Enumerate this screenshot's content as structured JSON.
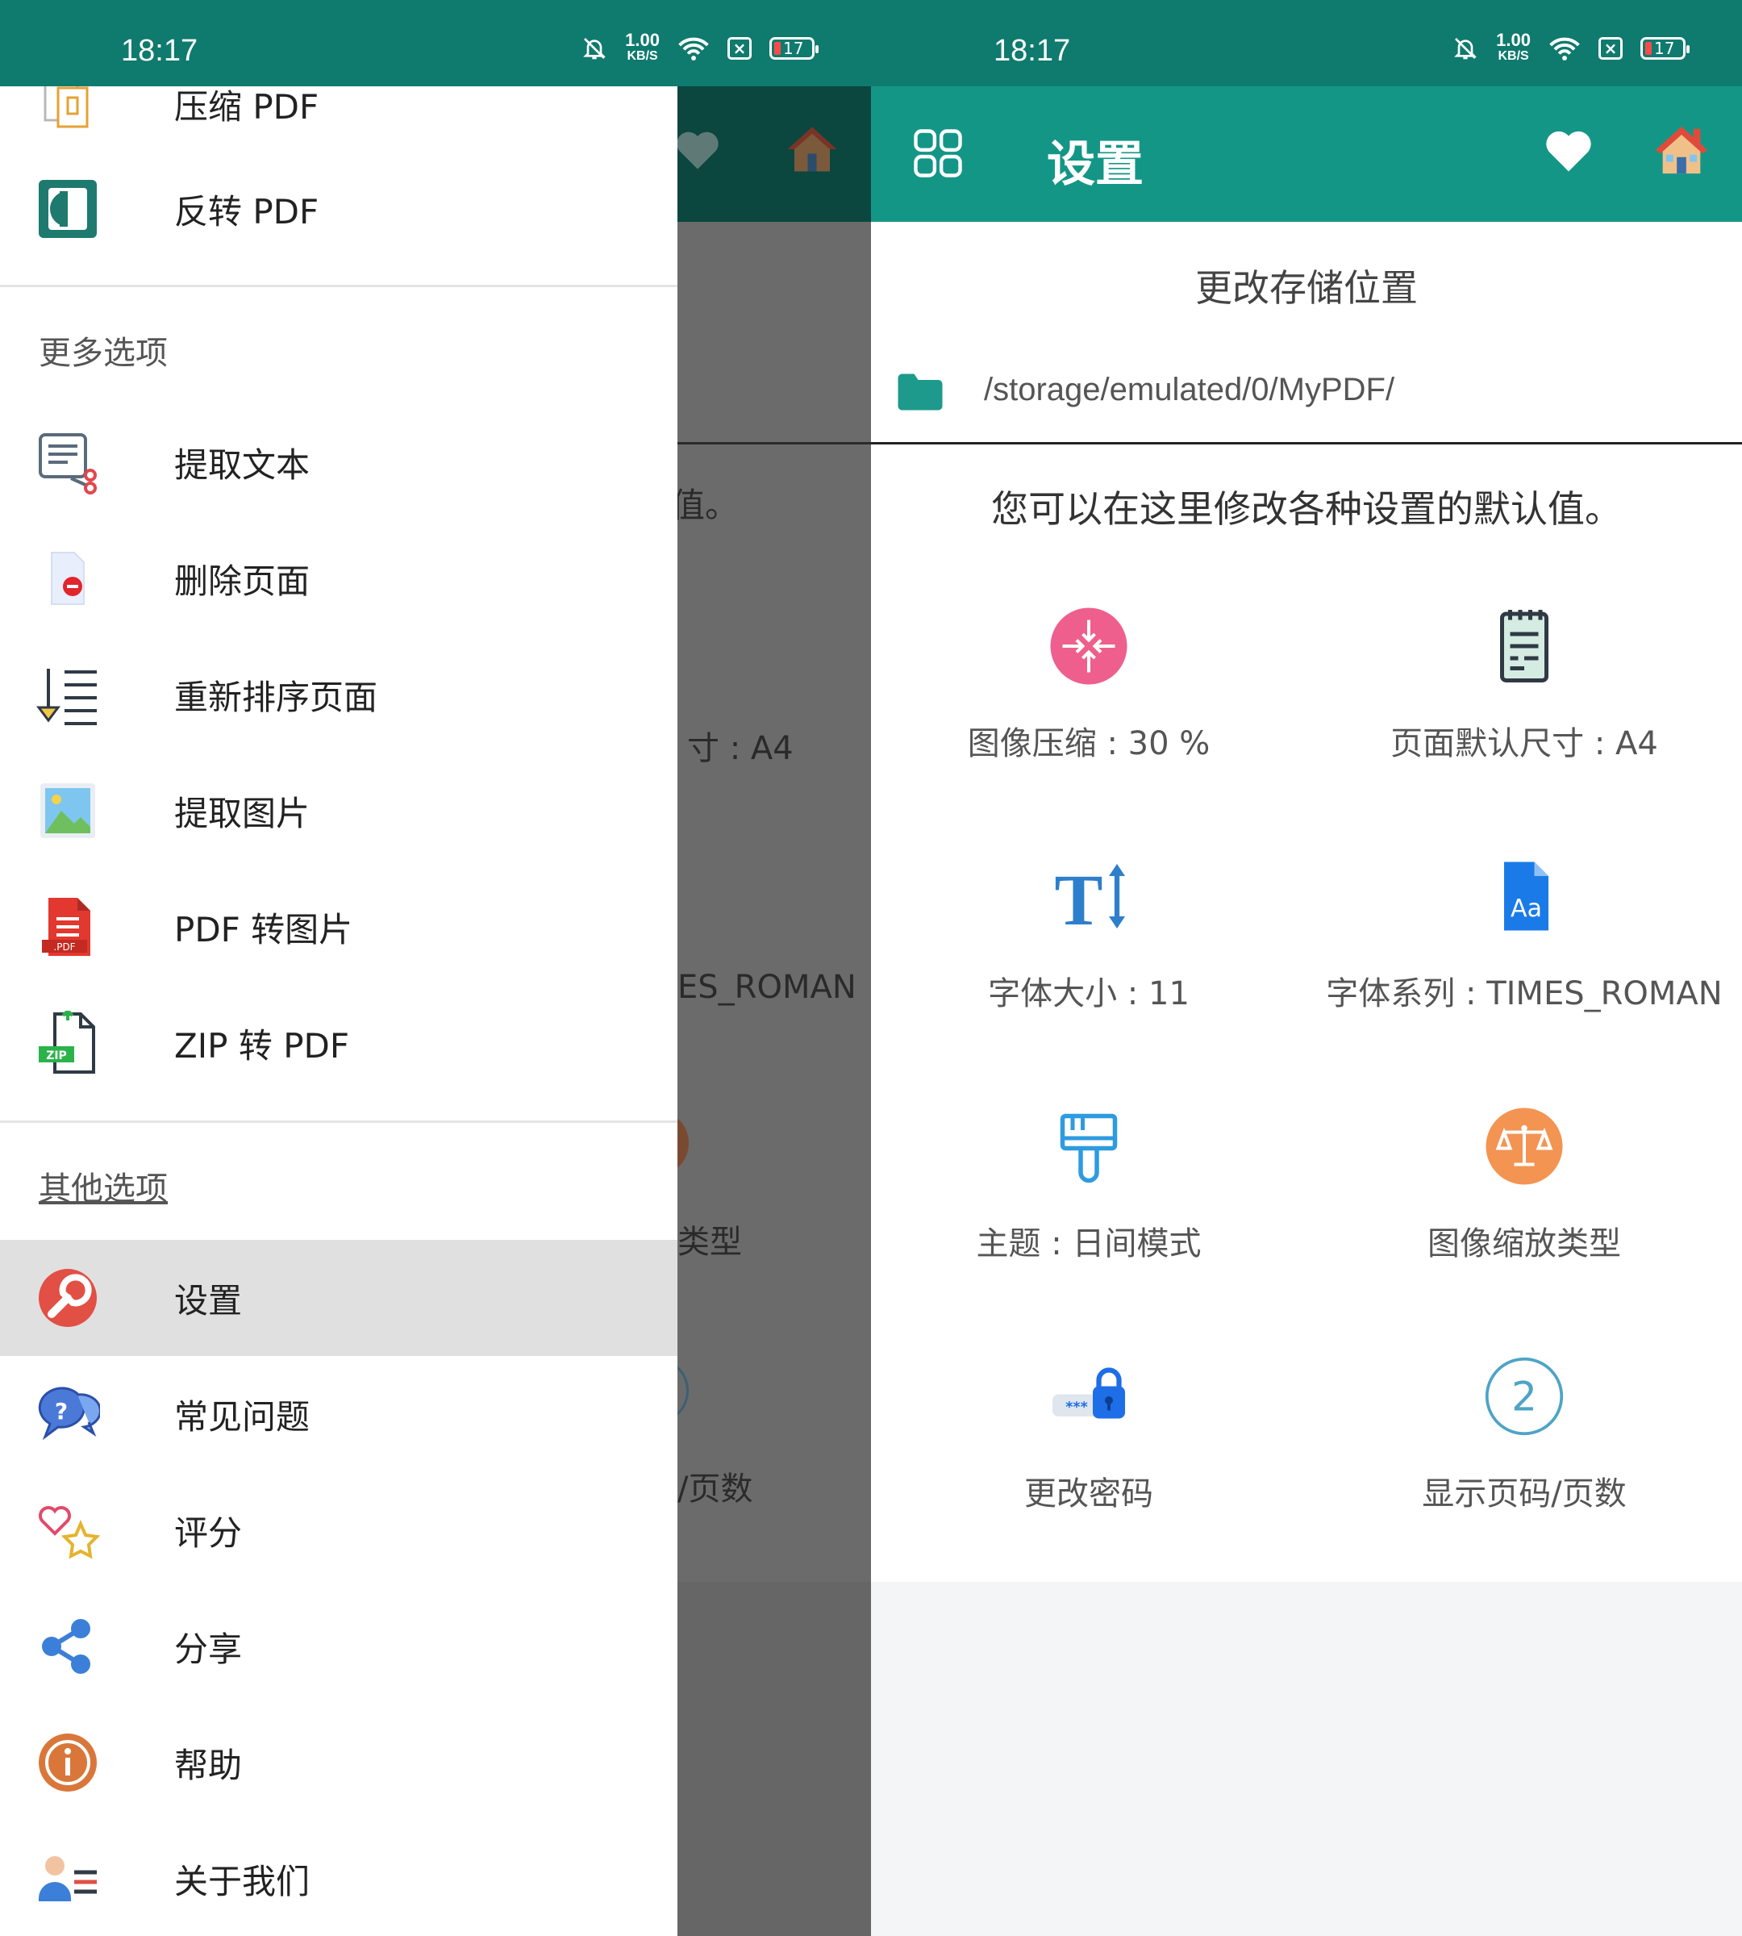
{
  "status": {
    "time": "18:17",
    "speed_value": "1.00",
    "speed_unit": "KB/S",
    "battery": "17"
  },
  "drawer": {
    "top_items": [
      {
        "label": "压缩 PDF",
        "icon": "compress-pdf-icon"
      },
      {
        "label": "反转 PDF",
        "icon": "invert-pdf-icon"
      }
    ],
    "section_more": "更多选项",
    "more_items": [
      {
        "label": "提取文本",
        "icon": "extract-text-icon"
      },
      {
        "label": "删除页面",
        "icon": "delete-page-icon"
      },
      {
        "label": "重新排序页面",
        "icon": "reorder-pages-icon"
      },
      {
        "label": "提取图片",
        "icon": "extract-images-icon"
      },
      {
        "label": "PDF 转图片",
        "icon": "pdf-to-image-icon"
      },
      {
        "label": "ZIP 转 PDF",
        "icon": "zip-to-pdf-icon"
      }
    ],
    "section_other": "其他选项",
    "other_items": [
      {
        "label": "设置",
        "icon": "settings-wrench-icon",
        "active": true
      },
      {
        "label": "常见问题",
        "icon": "faq-icon"
      },
      {
        "label": "评分",
        "icon": "rate-icon"
      },
      {
        "label": "分享",
        "icon": "share-icon"
      },
      {
        "label": "帮助",
        "icon": "help-info-icon"
      },
      {
        "label": "关于我们",
        "icon": "about-us-icon"
      }
    ]
  },
  "background_partial": {
    "info_fragment": "值。",
    "page_size_fragment": "寸 : A4",
    "font_family_fragment": "ES_ROMAN",
    "scale_type_fragment": "类型",
    "page_number_fragment": "/页数"
  },
  "settings": {
    "title": "设置",
    "storage_title": "更改存储位置",
    "storage_path": "/storage/emulated/0/MyPDF/",
    "info": "您可以在这里修改各种设置的默认值。",
    "options": [
      {
        "label": "图像压缩 : 30 %",
        "icon": "image-compression-icon"
      },
      {
        "label": "页面默认尺寸 : A4",
        "icon": "page-size-icon"
      },
      {
        "label": "字体大小 : 11",
        "icon": "font-size-icon"
      },
      {
        "label": "字体系列 : TIMES_ROMAN",
        "icon": "font-family-icon"
      },
      {
        "label": "主题 : 日间模式",
        "icon": "theme-brush-icon"
      },
      {
        "label": "图像缩放类型",
        "icon": "image-scale-icon"
      },
      {
        "label": "更改密码",
        "icon": "change-password-icon"
      },
      {
        "label": "显示页码/页数",
        "icon": "page-number-icon",
        "glyph": "2"
      }
    ]
  },
  "colors": {
    "status_bar": "#0f7a6e",
    "toolbar": "#149687",
    "drawer_active": "#e0e0e0"
  }
}
